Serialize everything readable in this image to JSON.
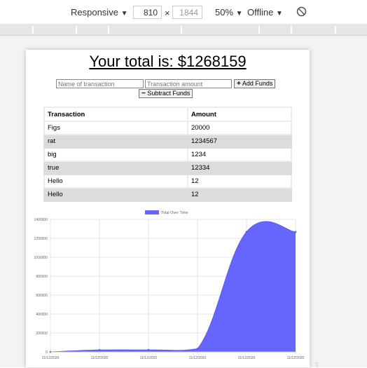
{
  "devtools": {
    "device": "Responsive",
    "width": "810",
    "height": "1844",
    "zoom": "50%",
    "network": "Offline",
    "times": "×"
  },
  "app": {
    "total_text": "Your total is: $1268159",
    "name_placeholder": "Name of transaction",
    "amount_placeholder": "Transaction amount",
    "add_label": "Add Funds",
    "subtract_label": "Subtract Funds"
  },
  "table": {
    "headers": [
      "Transaction",
      "Amount"
    ],
    "rows": [
      [
        "Figs",
        "20000"
      ],
      [
        "rat",
        "1234567"
      ],
      [
        "big",
        "1234"
      ],
      [
        "true",
        "12334"
      ],
      [
        "Hello",
        "12"
      ],
      [
        "Hello",
        "12"
      ]
    ]
  },
  "chart_data": {
    "type": "area",
    "legend": "Total Over Time",
    "legend_position": "top",
    "color": "#6666ff",
    "x": [
      "11/12/2020",
      "11/12/2020",
      "11/12/2020",
      "11/12/2020",
      "11/12/2020",
      "11/12/2020"
    ],
    "values": [
      0,
      20000,
      21234,
      33568,
      1268147,
      1268159
    ],
    "ylim": [
      0,
      1400000
    ],
    "yticks": [
      "0",
      "200000",
      "400000",
      "600000",
      "800000",
      "1000000",
      "1200000",
      "1400000"
    ],
    "grid": true
  }
}
